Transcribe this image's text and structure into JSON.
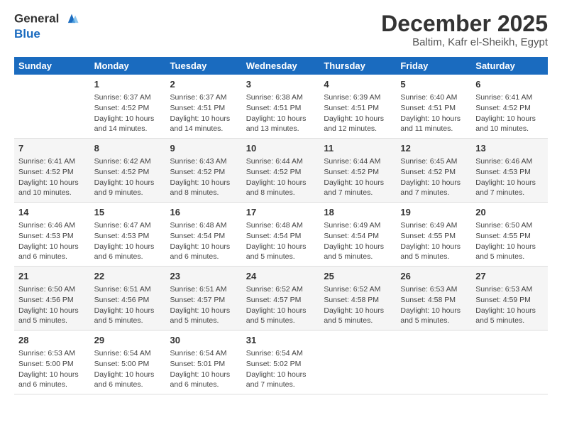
{
  "logo": {
    "line1": "General",
    "line2": "Blue"
  },
  "title": "December 2025",
  "location": "Baltim, Kafr el-Sheikh, Egypt",
  "headers": [
    "Sunday",
    "Monday",
    "Tuesday",
    "Wednesday",
    "Thursday",
    "Friday",
    "Saturday"
  ],
  "weeks": [
    [
      {
        "day": "",
        "sunrise": "",
        "sunset": "",
        "daylight": ""
      },
      {
        "day": "1",
        "sunrise": "Sunrise: 6:37 AM",
        "sunset": "Sunset: 4:52 PM",
        "daylight": "Daylight: 10 hours and 14 minutes."
      },
      {
        "day": "2",
        "sunrise": "Sunrise: 6:37 AM",
        "sunset": "Sunset: 4:51 PM",
        "daylight": "Daylight: 10 hours and 14 minutes."
      },
      {
        "day": "3",
        "sunrise": "Sunrise: 6:38 AM",
        "sunset": "Sunset: 4:51 PM",
        "daylight": "Daylight: 10 hours and 13 minutes."
      },
      {
        "day": "4",
        "sunrise": "Sunrise: 6:39 AM",
        "sunset": "Sunset: 4:51 PM",
        "daylight": "Daylight: 10 hours and 12 minutes."
      },
      {
        "day": "5",
        "sunrise": "Sunrise: 6:40 AM",
        "sunset": "Sunset: 4:51 PM",
        "daylight": "Daylight: 10 hours and 11 minutes."
      },
      {
        "day": "6",
        "sunrise": "Sunrise: 6:41 AM",
        "sunset": "Sunset: 4:52 PM",
        "daylight": "Daylight: 10 hours and 10 minutes."
      }
    ],
    [
      {
        "day": "7",
        "sunrise": "Sunrise: 6:41 AM",
        "sunset": "Sunset: 4:52 PM",
        "daylight": "Daylight: 10 hours and 10 minutes."
      },
      {
        "day": "8",
        "sunrise": "Sunrise: 6:42 AM",
        "sunset": "Sunset: 4:52 PM",
        "daylight": "Daylight: 10 hours and 9 minutes."
      },
      {
        "day": "9",
        "sunrise": "Sunrise: 6:43 AM",
        "sunset": "Sunset: 4:52 PM",
        "daylight": "Daylight: 10 hours and 8 minutes."
      },
      {
        "day": "10",
        "sunrise": "Sunrise: 6:44 AM",
        "sunset": "Sunset: 4:52 PM",
        "daylight": "Daylight: 10 hours and 8 minutes."
      },
      {
        "day": "11",
        "sunrise": "Sunrise: 6:44 AM",
        "sunset": "Sunset: 4:52 PM",
        "daylight": "Daylight: 10 hours and 7 minutes."
      },
      {
        "day": "12",
        "sunrise": "Sunrise: 6:45 AM",
        "sunset": "Sunset: 4:52 PM",
        "daylight": "Daylight: 10 hours and 7 minutes."
      },
      {
        "day": "13",
        "sunrise": "Sunrise: 6:46 AM",
        "sunset": "Sunset: 4:53 PM",
        "daylight": "Daylight: 10 hours and 7 minutes."
      }
    ],
    [
      {
        "day": "14",
        "sunrise": "Sunrise: 6:46 AM",
        "sunset": "Sunset: 4:53 PM",
        "daylight": "Daylight: 10 hours and 6 minutes."
      },
      {
        "day": "15",
        "sunrise": "Sunrise: 6:47 AM",
        "sunset": "Sunset: 4:53 PM",
        "daylight": "Daylight: 10 hours and 6 minutes."
      },
      {
        "day": "16",
        "sunrise": "Sunrise: 6:48 AM",
        "sunset": "Sunset: 4:54 PM",
        "daylight": "Daylight: 10 hours and 6 minutes."
      },
      {
        "day": "17",
        "sunrise": "Sunrise: 6:48 AM",
        "sunset": "Sunset: 4:54 PM",
        "daylight": "Daylight: 10 hours and 5 minutes."
      },
      {
        "day": "18",
        "sunrise": "Sunrise: 6:49 AM",
        "sunset": "Sunset: 4:54 PM",
        "daylight": "Daylight: 10 hours and 5 minutes."
      },
      {
        "day": "19",
        "sunrise": "Sunrise: 6:49 AM",
        "sunset": "Sunset: 4:55 PM",
        "daylight": "Daylight: 10 hours and 5 minutes."
      },
      {
        "day": "20",
        "sunrise": "Sunrise: 6:50 AM",
        "sunset": "Sunset: 4:55 PM",
        "daylight": "Daylight: 10 hours and 5 minutes."
      }
    ],
    [
      {
        "day": "21",
        "sunrise": "Sunrise: 6:50 AM",
        "sunset": "Sunset: 4:56 PM",
        "daylight": "Daylight: 10 hours and 5 minutes."
      },
      {
        "day": "22",
        "sunrise": "Sunrise: 6:51 AM",
        "sunset": "Sunset: 4:56 PM",
        "daylight": "Daylight: 10 hours and 5 minutes."
      },
      {
        "day": "23",
        "sunrise": "Sunrise: 6:51 AM",
        "sunset": "Sunset: 4:57 PM",
        "daylight": "Daylight: 10 hours and 5 minutes."
      },
      {
        "day": "24",
        "sunrise": "Sunrise: 6:52 AM",
        "sunset": "Sunset: 4:57 PM",
        "daylight": "Daylight: 10 hours and 5 minutes."
      },
      {
        "day": "25",
        "sunrise": "Sunrise: 6:52 AM",
        "sunset": "Sunset: 4:58 PM",
        "daylight": "Daylight: 10 hours and 5 minutes."
      },
      {
        "day": "26",
        "sunrise": "Sunrise: 6:53 AM",
        "sunset": "Sunset: 4:58 PM",
        "daylight": "Daylight: 10 hours and 5 minutes."
      },
      {
        "day": "27",
        "sunrise": "Sunrise: 6:53 AM",
        "sunset": "Sunset: 4:59 PM",
        "daylight": "Daylight: 10 hours and 5 minutes."
      }
    ],
    [
      {
        "day": "28",
        "sunrise": "Sunrise: 6:53 AM",
        "sunset": "Sunset: 5:00 PM",
        "daylight": "Daylight: 10 hours and 6 minutes."
      },
      {
        "day": "29",
        "sunrise": "Sunrise: 6:54 AM",
        "sunset": "Sunset: 5:00 PM",
        "daylight": "Daylight: 10 hours and 6 minutes."
      },
      {
        "day": "30",
        "sunrise": "Sunrise: 6:54 AM",
        "sunset": "Sunset: 5:01 PM",
        "daylight": "Daylight: 10 hours and 6 minutes."
      },
      {
        "day": "31",
        "sunrise": "Sunrise: 6:54 AM",
        "sunset": "Sunset: 5:02 PM",
        "daylight": "Daylight: 10 hours and 7 minutes."
      },
      {
        "day": "",
        "sunrise": "",
        "sunset": "",
        "daylight": ""
      },
      {
        "day": "",
        "sunrise": "",
        "sunset": "",
        "daylight": ""
      },
      {
        "day": "",
        "sunrise": "",
        "sunset": "",
        "daylight": ""
      }
    ]
  ]
}
